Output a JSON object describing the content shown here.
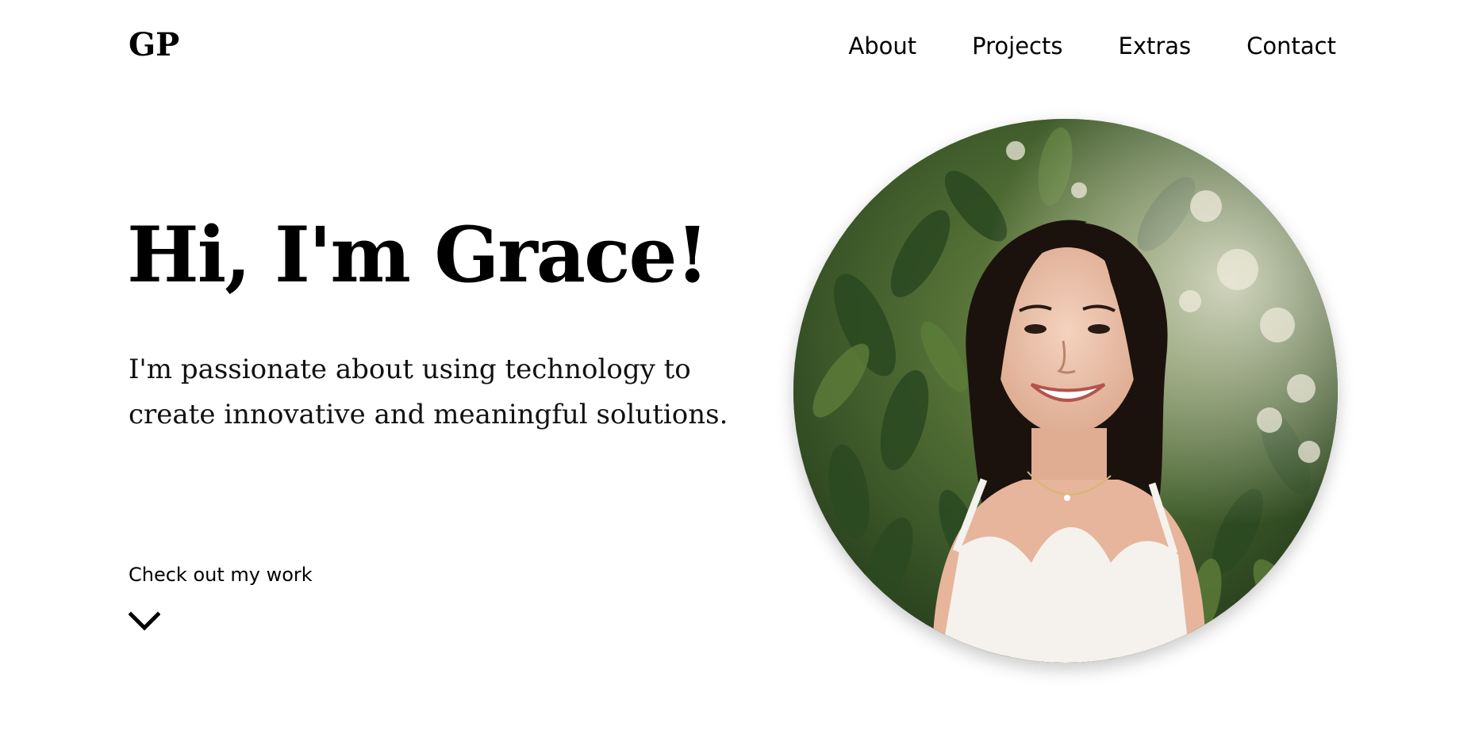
{
  "header": {
    "logo": "GP",
    "nav": [
      {
        "label": "About"
      },
      {
        "label": "Projects"
      },
      {
        "label": "Extras"
      },
      {
        "label": "Contact"
      }
    ]
  },
  "hero": {
    "title": "Hi, I'm Grace!",
    "subtitle": "I'm passionate about using technology to create innovative and meaningful solutions.",
    "cta_label": "Check out my work",
    "cta_icon": "chevron-down-icon",
    "portrait": "portrait-photo"
  },
  "colors": {
    "text": "#000000",
    "background": "#ffffff"
  }
}
